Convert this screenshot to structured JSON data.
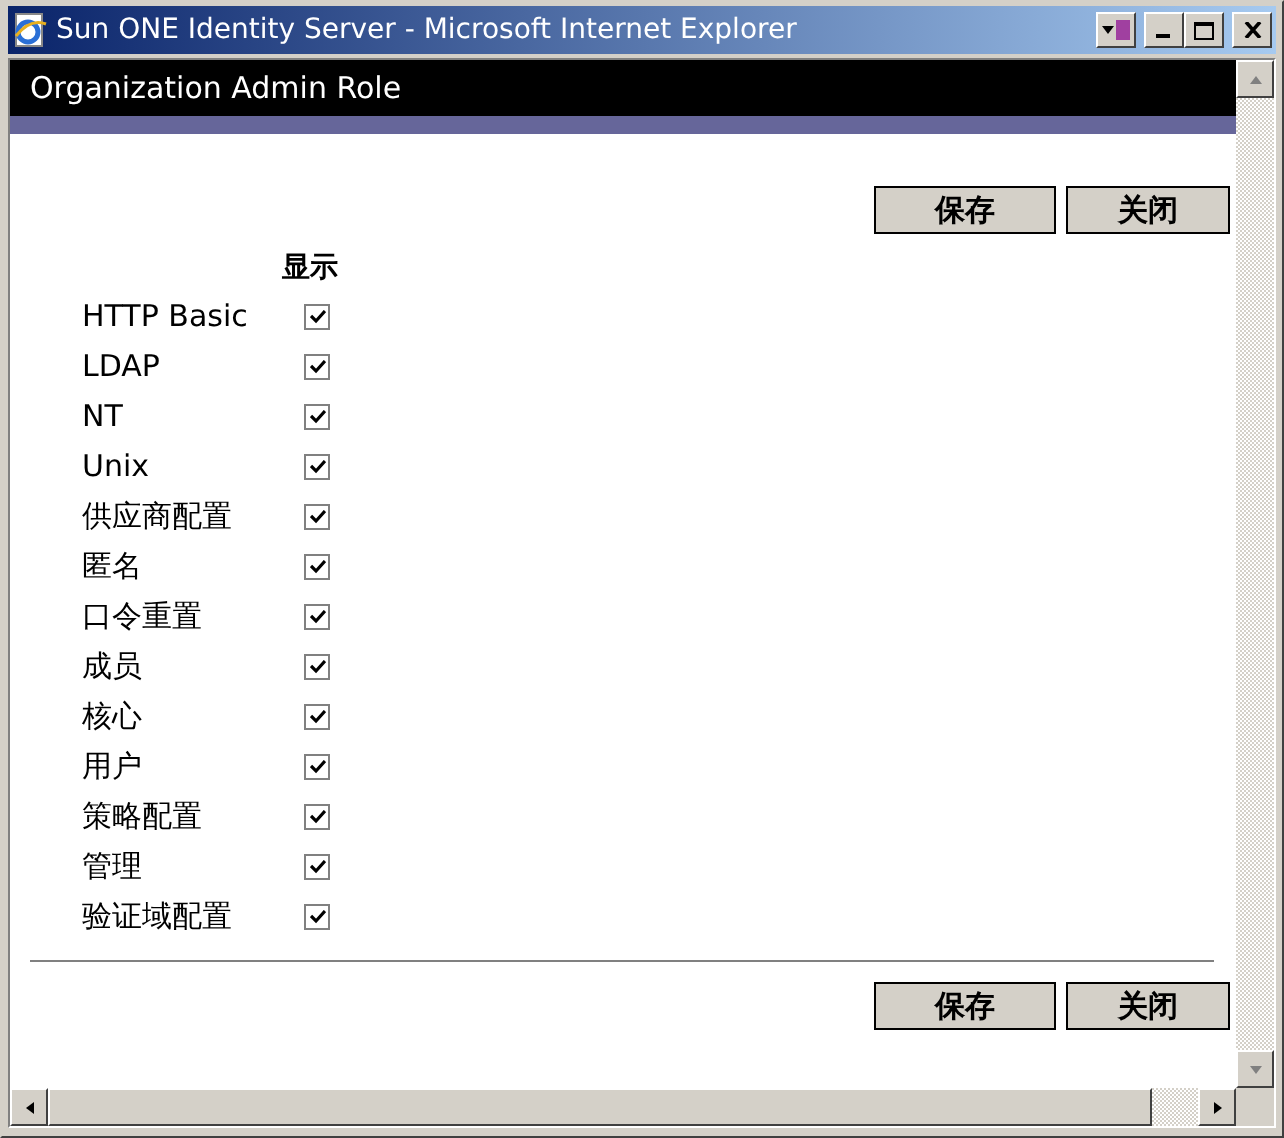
{
  "window": {
    "title": "Sun ONE Identity Server - Microsoft Internet Explorer"
  },
  "header": {
    "title": "Organization Admin Role"
  },
  "top_buttons": [
    "保存",
    "关闭"
  ],
  "column_heading": "显示",
  "rows": [
    {
      "label": "HTTP Basic",
      "checked": true
    },
    {
      "label": "LDAP",
      "checked": true
    },
    {
      "label": "NT",
      "checked": true
    },
    {
      "label": "Unix",
      "checked": true
    },
    {
      "label": "供应商配置",
      "checked": true
    },
    {
      "label": "匿名",
      "checked": true
    },
    {
      "label": "口令重置",
      "checked": true
    },
    {
      "label": "成员",
      "checked": true
    },
    {
      "label": "核心",
      "checked": true
    },
    {
      "label": "用户",
      "checked": true
    },
    {
      "label": "策略配置",
      "checked": true
    },
    {
      "label": "管理",
      "checked": true
    },
    {
      "label": "验证域配置",
      "checked": true
    }
  ],
  "bottom_buttons": [
    "保存",
    "关闭"
  ]
}
